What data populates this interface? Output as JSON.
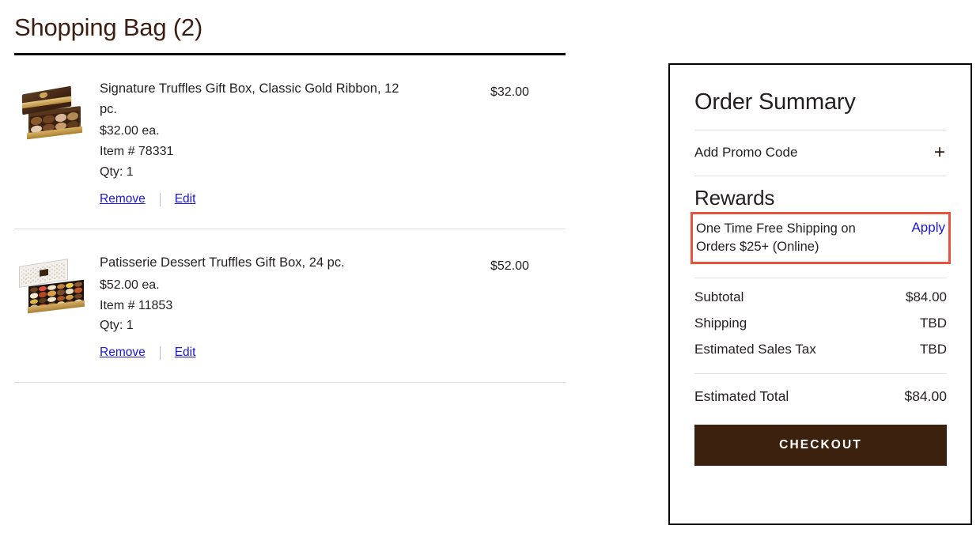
{
  "page": {
    "title": "Shopping Bag (2)"
  },
  "bag": {
    "items": [
      {
        "name": "Signature Truffles Gift Box, Classic Gold Ribbon, 12 pc.",
        "unit_price": "$32.00 ea.",
        "item_number": "Item # 78331",
        "qty": "Qty: 1",
        "price": "$32.00",
        "remove_label": "Remove",
        "edit_label": "Edit",
        "thumb_alt": "dark-brown-gift-box-with-gold-ribbon"
      },
      {
        "name": "Patisserie Dessert Truffles Gift Box, 24 pc.",
        "unit_price": "$52.00 ea.",
        "item_number": "Item # 11853",
        "qty": "Qty: 1",
        "price": "$52.00",
        "remove_label": "Remove",
        "edit_label": "Edit",
        "thumb_alt": "white-patterned-gift-box-with-colorful-truffles"
      }
    ]
  },
  "summary": {
    "title": "Order Summary",
    "promo": {
      "label": "Add Promo Code",
      "expand_icon": "plus-icon",
      "icon_glyph": "+"
    },
    "rewards": {
      "heading": "Rewards",
      "offer_text": "One Time Free Shipping on Orders $25+ (Online)",
      "apply_label": "Apply",
      "highlight_color": "#e8523f"
    },
    "totals": [
      {
        "label": "Subtotal",
        "value": "$84.00"
      },
      {
        "label": "Shipping",
        "value": "TBD"
      },
      {
        "label": "Estimated Sales Tax",
        "value": "TBD"
      }
    ],
    "grand_total": {
      "label": "Estimated Total",
      "value": "$84.00"
    },
    "checkout_label": "CHECKOUT",
    "checkout_color": "#3c210f"
  }
}
